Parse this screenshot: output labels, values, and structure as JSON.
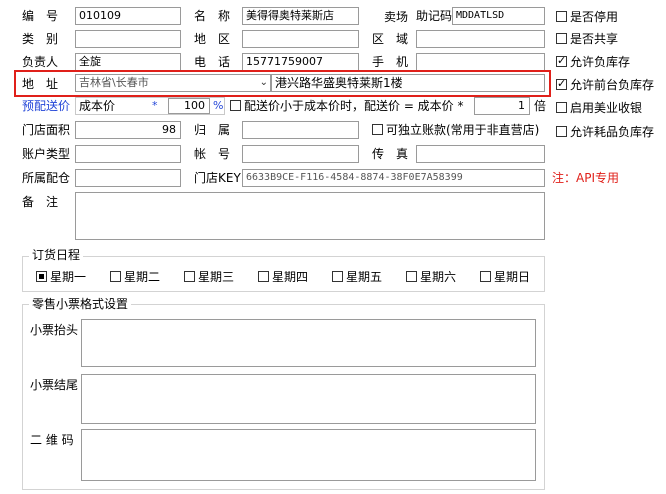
{
  "form": {
    "code": {
      "label": "编　号",
      "value": "010109"
    },
    "name": {
      "label": "名　称",
      "value": "美得得奥特莱斯店"
    },
    "floor_label": "卖场",
    "mnemonic": {
      "label": "助记码",
      "value": "MDDATLSD"
    },
    "category": {
      "label": "类　别",
      "value": ""
    },
    "region": {
      "label": "地　区",
      "value": ""
    },
    "area": {
      "label": "区　域",
      "value": ""
    },
    "manager": {
      "label": "负责人",
      "value": "全旋"
    },
    "phone": {
      "label": "电　话",
      "value": "15771759007"
    },
    "mobile": {
      "label": "手　机",
      "value": ""
    },
    "address": {
      "label": "地　址",
      "province": "吉林省\\长春市",
      "street": "港兴路华盛奥特莱斯1楼"
    },
    "delivery_price": {
      "label": "预配送价",
      "base": "成本价",
      "multiplier": "100",
      "percent": "%"
    },
    "below_cost": {
      "label": "配送价小于成本价时，配送价 = 成本价 *",
      "factor": "1",
      "suffix": "倍"
    },
    "store_area": {
      "label": "门店面积",
      "value": "98"
    },
    "belong": {
      "label": "归　属",
      "value": ""
    },
    "independent": {
      "label": "可独立账款(常用于非直营店)"
    },
    "account_type": {
      "label": "账户类型",
      "value": ""
    },
    "account_no": {
      "label": "帐　号",
      "value": ""
    },
    "fax": {
      "label": "传　真",
      "value": ""
    },
    "warehouse": {
      "label": "所属配仓",
      "value": ""
    },
    "store_key": {
      "label": "门店KEY",
      "value": "6633B9CE-F116-4584-8874-38F0E7A58399"
    },
    "api_note": "注：API专用",
    "remark": {
      "label": "备　注",
      "value": ""
    }
  },
  "options": [
    {
      "label": "是否停用",
      "checked": false
    },
    {
      "label": "是否共享",
      "checked": false
    },
    {
      "label": "允许负库存",
      "checked": true
    },
    {
      "label": "允许前台负库存",
      "checked": true
    },
    {
      "label": "启用美业收银",
      "checked": false
    },
    {
      "label": "允许耗品负库存",
      "checked": false
    }
  ],
  "order_schedule": {
    "title": "订货日程",
    "days": [
      {
        "label": "星期一",
        "checked": true
      },
      {
        "label": "星期二",
        "checked": false
      },
      {
        "label": "星期三",
        "checked": false
      },
      {
        "label": "星期四",
        "checked": false
      },
      {
        "label": "星期五",
        "checked": false
      },
      {
        "label": "星期六",
        "checked": false
      },
      {
        "label": "星期日",
        "checked": false
      }
    ]
  },
  "receipt": {
    "title": "零售小票格式设置",
    "header_label": "小票抬头",
    "footer_label": "小票结尾",
    "qrcode_label": "二 维 码"
  },
  "colors": {
    "highlight_border": "#e0201a",
    "blue_label": "#2346d8"
  }
}
